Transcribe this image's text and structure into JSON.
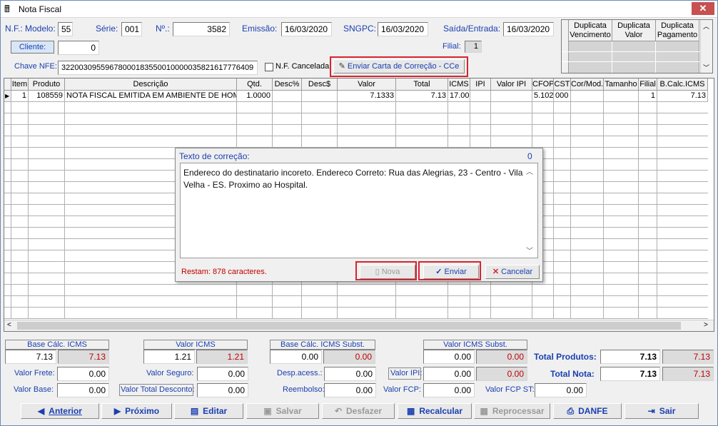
{
  "window": {
    "title": "Nota Fiscal",
    "close_label": "✕"
  },
  "header": {
    "nf_modelo_label": "N.F.: Modelo:",
    "nf_modelo": "55",
    "serie_label": "Série:",
    "serie": "001",
    "numero_label": "Nº.:",
    "numero": "3582",
    "emissao_label": "Emissão:",
    "emissao": "16/03/2020",
    "sngpc_label": "SNGPC:",
    "sngpc": "16/03/2020",
    "saida_label": "Saída/Entrada:",
    "saida": "16/03/2020",
    "cliente_label": "Cliente:",
    "cliente": "0",
    "filial_label": "Filial:",
    "filial": "1",
    "chave_label": "Chave NFE:",
    "chave": "32200309559678000183550010000035821617776409",
    "cancelada_label": "N.F. Cancelada",
    "cce_button": "Enviar Carta de Correção - CCe"
  },
  "duplicates": {
    "headers": [
      "Duplicata Vencimento",
      "Duplicata Valor",
      "Duplicata Pagamento"
    ]
  },
  "grid": {
    "columns": [
      "Item",
      "Produto",
      "Descrição",
      "Qtd.",
      "Desc%",
      "Desc$",
      "Valor",
      "Total",
      "ICMS",
      "IPI",
      "Valor IPI",
      "CFOP",
      "CST",
      "Cor/Mod.",
      "Tamanho",
      "Filial",
      "B.Calc.ICMS"
    ],
    "rows": [
      {
        "item": "1",
        "produto": "108559",
        "descricao": "NOTA FISCAL EMITIDA EM AMBIENTE DE HOMOLO",
        "qtd": "1.0000",
        "desc_pct": "",
        "desc_val": "",
        "valor": "7.1333",
        "total": "7.13",
        "icms": "17.00",
        "ipi": "",
        "valor_ipi": "",
        "cfop": "5.102",
        "cst": "000",
        "cor_mod": "",
        "tamanho": "",
        "filial": "1",
        "bcalc": "7.13"
      }
    ]
  },
  "dialog": {
    "title": "Texto de correção:",
    "count": "0",
    "text": "Endereco do destinatario incoreto. Endereco Correto: Rua das Alegrias, 23 - Centro - Vila Velha - ES. Proximo ao Hospital.",
    "remaining": "Restam: 878  caracteres.",
    "nova": "Nova",
    "enviar": "Enviar",
    "cancelar": "Cancelar"
  },
  "totals": {
    "base_icms_label": "Base Cálc. ICMS",
    "base_icms": "7.13",
    "base_icms_ref": "7.13",
    "valor_icms_label": "Valor ICMS",
    "valor_icms": "1.21",
    "valor_icms_ref": "1.21",
    "base_subst_label": "Base Cálc. ICMS Subst.",
    "base_subst": "0.00",
    "base_subst_ref": "0.00",
    "valor_subst_label": "Valor ICMS Subst.",
    "valor_subst": "0.00",
    "valor_subst_ref": "0.00",
    "total_produtos_label": "Total Produtos:",
    "total_produtos": "7.13",
    "total_produtos_ref": "7.13",
    "frete_label": "Valor Frete:",
    "frete": "0.00",
    "seguro_label": "Valor Seguro:",
    "seguro": "0.00",
    "desp_label": "Desp.acess.:",
    "desp": "0.00",
    "ipi_label": "Valor IPI:",
    "ipi": "0.00",
    "ipi_ref": "0.00",
    "total_nota_label": "Total Nota:",
    "total_nota": "7.13",
    "total_nota_ref": "7.13",
    "vbase_label": "Valor Base:",
    "vbase": "0.00",
    "desconto_label": "Valor Total Desconto:",
    "desconto": "0.00",
    "reembolso_label": "Reembolso:",
    "reembolso": "0.00",
    "fcp_label": "Valor FCP:",
    "fcp": "0.00",
    "fcp_st_label": "Valor FCP ST:",
    "fcp_st": "0.00"
  },
  "toolbar": {
    "anterior": "Anterior",
    "proximo": "Próximo",
    "editar": "Editar",
    "salvar": "Salvar",
    "desfazer": "Desfazer",
    "recalcular": "Recalcular",
    "reprocessar": "Reprocessar",
    "danfe": "DANFE",
    "sair": "Sair"
  },
  "colors": {
    "label_blue": "#1a3fb0",
    "highlight_red": "#d9232d",
    "value_red": "#c00000"
  }
}
